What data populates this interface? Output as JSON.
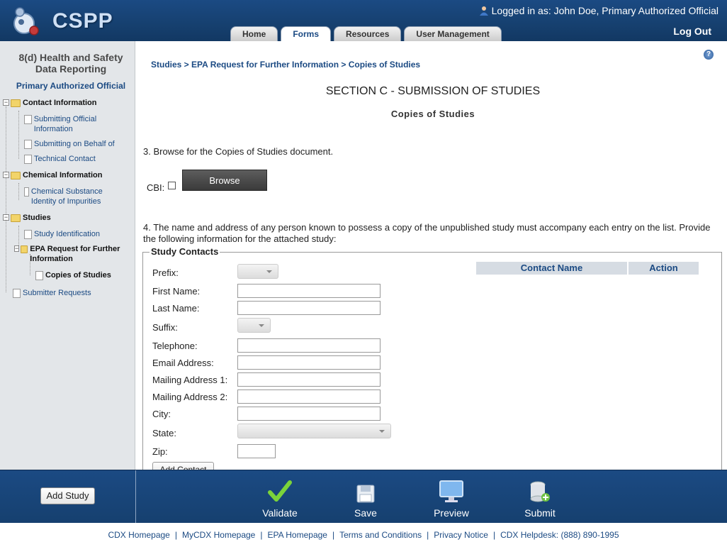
{
  "header": {
    "logo_text": "CSPP",
    "login_text": "Logged in as: John Doe, Primary Authorized Official",
    "tabs": [
      "Home",
      "Forms",
      "Resources",
      "User Management"
    ],
    "active_tab": "Forms",
    "logout": "Log Out"
  },
  "sidebar": {
    "title": "8(d) Health and Safety Data Reporting",
    "role": "Primary Authorized Official",
    "tree": {
      "contact_info": "Contact Information",
      "submitting_official": "Submitting Official Information",
      "submitting_on_behalf": "Submitting on Behalf of",
      "technical_contact": "Technical Contact",
      "chemical_info": "Chemical Information",
      "chemical_substance": "Chemical Substance Identity of Impurities",
      "studies": "Studies",
      "study_identification": "Study Identification",
      "epa_request": "EPA Request for Further Information",
      "copies_of_studies": "Copies of Studies",
      "submitter_requests": "Submitter Requests"
    }
  },
  "main": {
    "breadcrumb": [
      "Studies",
      "EPA Request for Further Information",
      "Copies of Studies"
    ],
    "breadcrumb_sep": " > ",
    "section_title": "SECTION C - SUBMISSION OF STUDIES",
    "subtitle": "Copies of Studies",
    "q3": "3. Browse for the Copies of Studies document.",
    "cbi_label": "CBI:",
    "browse": "Browse",
    "q4": "4. The name and address of any person known to possess a copy of the unpublished study must accompany each entry on the list. Provide the following information for the attached study:",
    "legend": "Study Contacts",
    "fields": {
      "prefix": "Prefix:",
      "first_name": "First Name:",
      "last_name": "Last Name:",
      "suffix": "Suffix:",
      "telephone": "Telephone:",
      "email": "Email Address:",
      "mailing1": "Mailing Address 1:",
      "mailing2": "Mailing Address 2:",
      "city": "City:",
      "state": "State:",
      "zip": "Zip:"
    },
    "add_contact": "Add Contact",
    "table_headers": [
      "Contact Name",
      "Action"
    ]
  },
  "toolbar": {
    "add_study": "Add Study",
    "validate": "Validate",
    "save": "Save",
    "preview": "Preview",
    "submit": "Submit"
  },
  "footer": {
    "links": [
      "CDX Homepage",
      "MyCDX Homepage",
      "EPA Homepage",
      "Terms and Conditions",
      "Privacy Notice",
      "CDX Helpdesk: (888) 890-1995"
    ]
  }
}
